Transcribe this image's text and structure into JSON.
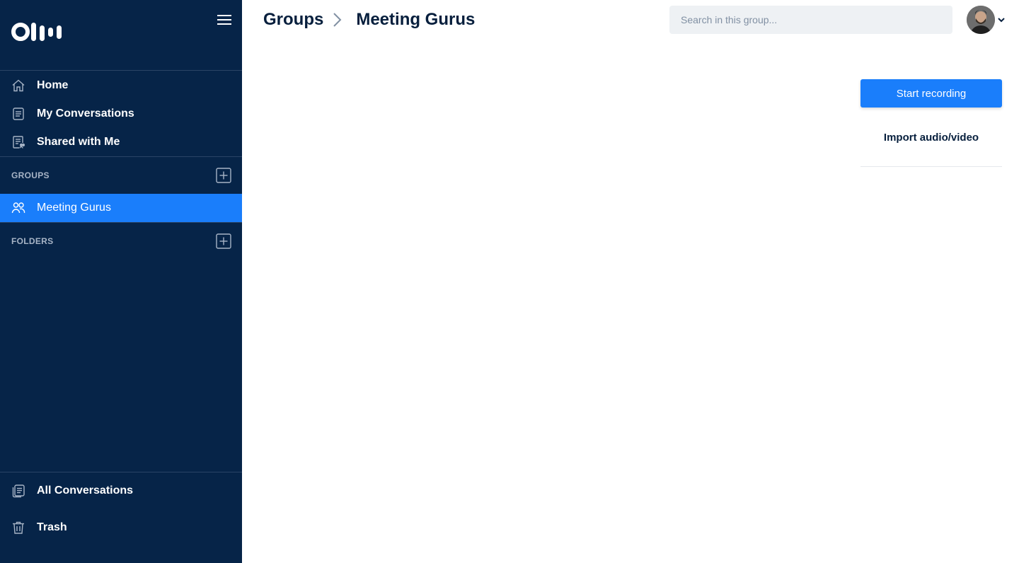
{
  "app": {
    "logo_name": "otter-logo",
    "accent_color": "#1a7efb",
    "sidebar_color": "#062448"
  },
  "sidebar": {
    "nav": [
      {
        "label": "Home",
        "icon": "home-icon"
      },
      {
        "label": "My Conversations",
        "icon": "document-icon"
      },
      {
        "label": "Shared with Me",
        "icon": "shared-document-icon"
      }
    ],
    "groups_header": "GROUPS",
    "groups": [
      {
        "label": "Meeting Gurus",
        "icon": "people-icon",
        "active": true
      }
    ],
    "folders_header": "FOLDERS",
    "bottom": [
      {
        "label": "All Conversations",
        "icon": "documents-stack-icon"
      },
      {
        "label": "Trash",
        "icon": "trash-icon"
      }
    ]
  },
  "header": {
    "breadcrumb_root": "Groups",
    "breadcrumb_current": "Meeting Gurus",
    "search_placeholder": "Search in this group..."
  },
  "actions": {
    "start_recording": "Start recording",
    "import": "Import audio/video"
  }
}
